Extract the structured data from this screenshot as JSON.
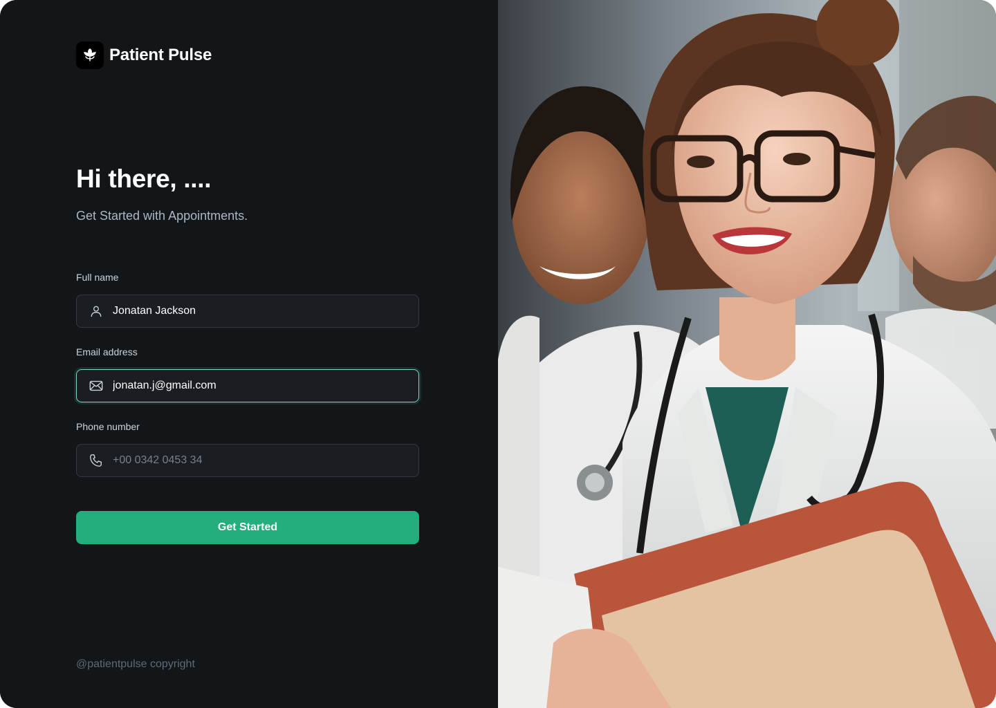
{
  "brand": {
    "name": "Patient Pulse",
    "logo_icon": "flower-logo-icon"
  },
  "hero": {
    "greeting": "Hi there, ....",
    "subtitle": "Get Started with Appointments."
  },
  "form": {
    "full_name": {
      "label": "Full name",
      "value": "Jonatan Jackson",
      "icon": "user-icon"
    },
    "email": {
      "label": "Email address",
      "value": "jonatan.j@gmail.com",
      "icon": "mail-icon"
    },
    "phone": {
      "label": "Phone number",
      "placeholder": "+00 0342 0453 34",
      "value": "",
      "icon": "phone-icon"
    },
    "submit_label": "Get Started"
  },
  "footer": {
    "copyright": "@patientpulse copyright"
  },
  "colors": {
    "background": "#131619",
    "input_bg": "#1a1d21",
    "input_border": "#363a3d",
    "focus_border": "#7fd7c4",
    "accent": "#24ae7c"
  }
}
